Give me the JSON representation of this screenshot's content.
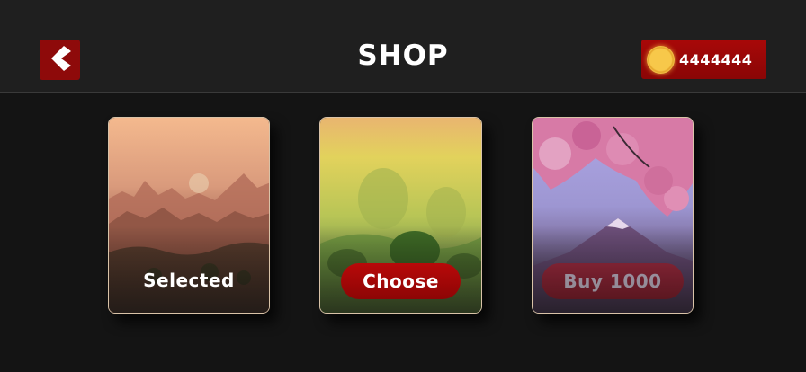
{
  "header": {
    "title": "SHOP",
    "back_icon": "chevron-left-icon",
    "coins": {
      "icon": "coin-icon",
      "amount": "4444444"
    }
  },
  "cards": [
    {
      "theme": "misty-mountains-sunset",
      "label": "Selected",
      "state": "selected"
    },
    {
      "theme": "foggy-green-forest",
      "label": "Choose",
      "state": "available"
    },
    {
      "theme": "cherry-blossom-mount-fuji",
      "label": "Buy 1000",
      "state": "locked"
    }
  ],
  "colors": {
    "accent_red": "#a80808",
    "background": "#141414",
    "header_bg": "#1f1f1f"
  }
}
